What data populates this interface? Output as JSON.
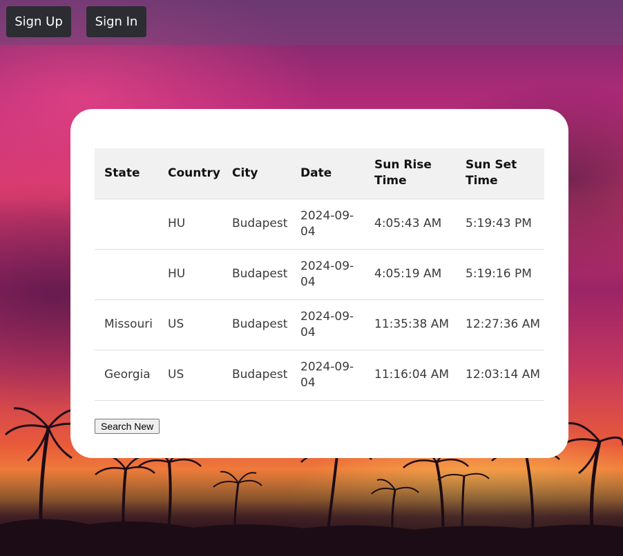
{
  "nav": {
    "sign_up": "Sign Up",
    "sign_in": "Sign In"
  },
  "table": {
    "headers": [
      "State",
      "Country",
      "City",
      "Date",
      "Sun Rise Time",
      "Sun Set Time"
    ],
    "rows": [
      {
        "state": "",
        "country": "HU",
        "city": "Budapest",
        "date": "2024-09-04",
        "sunrise": "4:05:43 AM",
        "sunset": "5:19:43 PM"
      },
      {
        "state": "",
        "country": "HU",
        "city": "Budapest",
        "date": "2024-09-04",
        "sunrise": "4:05:19 AM",
        "sunset": "5:19:16 PM"
      },
      {
        "state": "Missouri",
        "country": "US",
        "city": "Budapest",
        "date": "2024-09-04",
        "sunrise": "11:35:38 AM",
        "sunset": "12:27:36 AM"
      },
      {
        "state": "Georgia",
        "country": "US",
        "city": "Budapest",
        "date": "2024-09-04",
        "sunrise": "11:16:04 AM",
        "sunset": "12:03:14 AM"
      }
    ]
  },
  "search_new": "Search New"
}
